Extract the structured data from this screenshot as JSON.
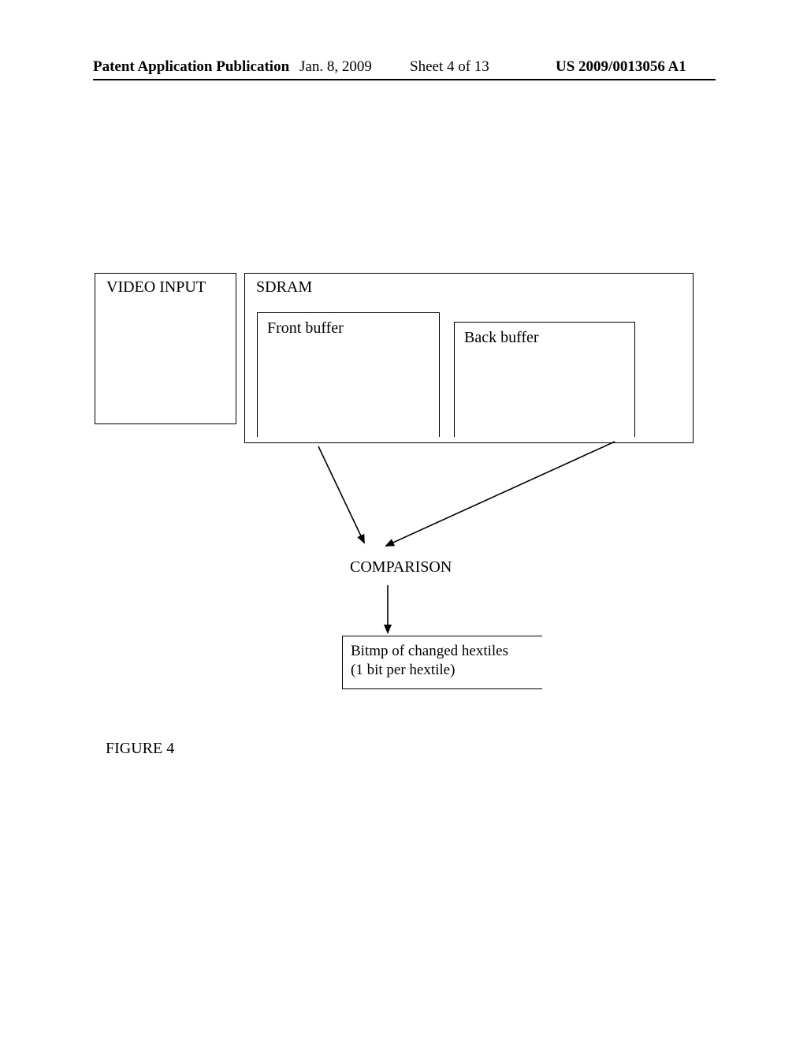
{
  "header": {
    "publication_label": "Patent Application Publication",
    "date": "Jan. 8, 2009",
    "sheet": "Sheet 4 of 13",
    "pub_number": "US 2009/0013056 A1"
  },
  "diagram": {
    "video_input": "VIDEO INPUT",
    "sdram": "SDRAM",
    "front_buffer": "Front buffer",
    "back_buffer": "Back buffer",
    "comparison": "COMPARISON",
    "bitmap_line1": "Bitmp of changed hextiles",
    "bitmap_line2": "(1 bit per hextile)"
  },
  "figure_label": "FIGURE 4"
}
